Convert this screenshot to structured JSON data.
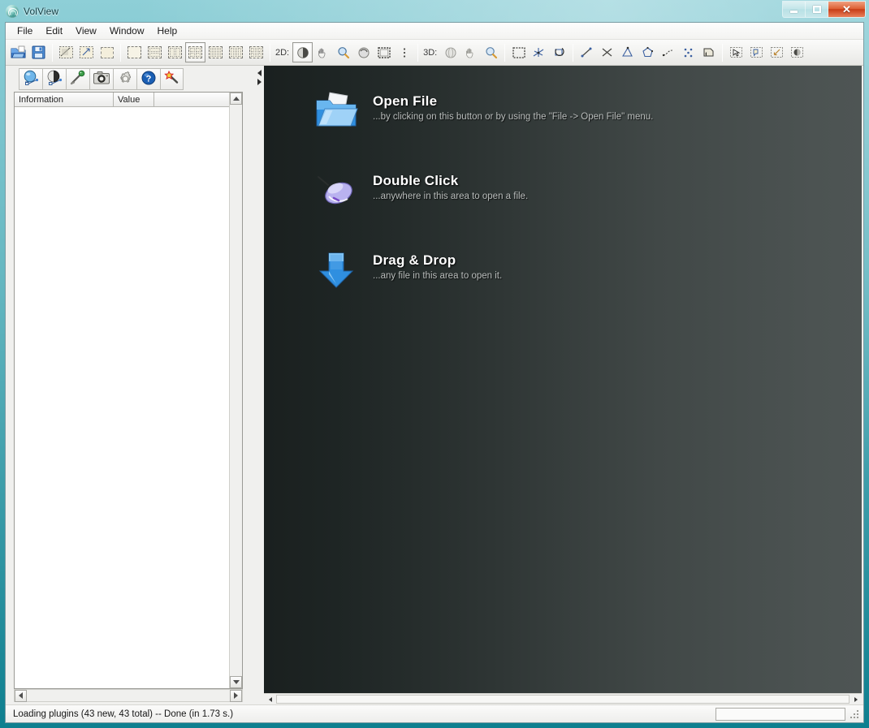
{
  "window": {
    "title": "VolView",
    "logo_icon": "volview-swirl-logo",
    "controls": {
      "minimize": {
        "icon": "minimize-icon",
        "label": "Minimize"
      },
      "maximize": {
        "icon": "maximize-icon",
        "label": "Maximize"
      },
      "close": {
        "icon": "close-icon",
        "label": "Close",
        "glyph": "✕"
      }
    }
  },
  "menubar": {
    "items": [
      {
        "label": "File"
      },
      {
        "label": "Edit"
      },
      {
        "label": "View"
      },
      {
        "label": "Window"
      },
      {
        "label": "Help"
      }
    ]
  },
  "toolbar": {
    "file_group": [
      {
        "name": "open-file-button",
        "icon": "open-folder-icon",
        "tooltip": "Open File"
      },
      {
        "name": "save-button",
        "icon": "floppy-save-icon",
        "tooltip": "Save"
      }
    ],
    "document_group": [
      {
        "name": "doc-crop-button",
        "icon": "document-crop-icon"
      },
      {
        "name": "doc-extract-button",
        "icon": "document-extract-icon"
      },
      {
        "name": "doc-blank-button",
        "icon": "document-blank-icon"
      }
    ],
    "layout_group": [
      {
        "name": "layout-single-button",
        "icon": "layout-single-icon",
        "selected": false
      },
      {
        "name": "layout-two-horizontal-button",
        "icon": "layout-2-horizontal-icon",
        "selected": false
      },
      {
        "name": "layout-two-vertical-button",
        "icon": "layout-2-vertical-icon",
        "selected": false
      },
      {
        "name": "layout-quad-button",
        "icon": "layout-quad-icon",
        "selected": true
      },
      {
        "name": "layout-one-plus-three-button",
        "icon": "layout-1-plus-3-icon",
        "selected": false
      },
      {
        "name": "layout-three-columns-button",
        "icon": "layout-3-columns-icon",
        "selected": false
      },
      {
        "name": "layout-six-grid-button",
        "icon": "layout-6-grid-icon",
        "selected": false
      }
    ],
    "mode_2d": {
      "label": "2D:",
      "tools": [
        {
          "name": "tool-2d-window-level-button",
          "icon": "window-level-icon",
          "selected": true
        },
        {
          "name": "tool-2d-pan-button",
          "icon": "hand-pan-icon",
          "selected": false
        },
        {
          "name": "tool-2d-zoom-button",
          "icon": "magnifier-zoom-icon",
          "selected": false
        },
        {
          "name": "tool-2d-rotate-button",
          "icon": "rotate-icon",
          "selected": false
        },
        {
          "name": "tool-2d-crop-button",
          "icon": "crop-box-icon",
          "selected": false
        },
        {
          "name": "tool-2d-more-button",
          "icon": "more-vertical-icon",
          "selected": false
        }
      ]
    },
    "mode_3d": {
      "label": "3D:",
      "tools": [
        {
          "name": "tool-3d-rotate-button",
          "icon": "sphere-rotate-icon",
          "selected": false
        },
        {
          "name": "tool-3d-pan-button",
          "icon": "hand-pan-icon",
          "selected": false
        },
        {
          "name": "tool-3d-zoom-button",
          "icon": "magnifier-zoom-icon",
          "selected": false
        }
      ]
    },
    "crop_group": [
      {
        "name": "crop-region-button",
        "icon": "crop-box-icon"
      },
      {
        "name": "axes-button",
        "icon": "axes-cross-icon"
      },
      {
        "name": "reset-view-button",
        "icon": "reset-rotate-icon"
      }
    ],
    "measure_group": [
      {
        "name": "measure-ruler-button",
        "icon": "ruler-distance-icon"
      },
      {
        "name": "measure-cross-button",
        "icon": "cross-distance-icon"
      },
      {
        "name": "measure-angle-button",
        "icon": "angle-icon"
      },
      {
        "name": "measure-polygon-button",
        "icon": "polygon-icon"
      },
      {
        "name": "measure-path-button",
        "icon": "path-points-icon"
      },
      {
        "name": "measure-scatter-button",
        "icon": "scatter-points-icon"
      },
      {
        "name": "measure-volume-button",
        "icon": "volume-measure-icon"
      }
    ],
    "annotate_group": [
      {
        "name": "annotate-select-button",
        "icon": "lasso-select-icon"
      },
      {
        "name": "annotate-note-button",
        "icon": "note-tag-icon"
      },
      {
        "name": "annotate-arrow-button",
        "icon": "arrow-tag-icon"
      },
      {
        "name": "annotate-fill-button",
        "icon": "fill-region-icon"
      }
    ]
  },
  "left_panel": {
    "tabs": [
      {
        "name": "tab-volume-properties",
        "icon": "blue-sphere-icon"
      },
      {
        "name": "tab-surface-properties",
        "icon": "gray-sphere-icon"
      },
      {
        "name": "tab-probe",
        "icon": "probe-pin-icon"
      },
      {
        "name": "tab-snapshot",
        "icon": "camera-icon"
      },
      {
        "name": "tab-settings",
        "icon": "gear-icon"
      },
      {
        "name": "tab-help",
        "icon": "help-question-icon"
      },
      {
        "name": "tab-plugins",
        "icon": "magic-wand-icon"
      }
    ],
    "info_table": {
      "columns": [
        "Information",
        "Value",
        ""
      ],
      "rows": []
    },
    "scrollbars": {
      "vertical": {
        "up_icon": "scroll-up-arrow-icon",
        "down_icon": "scroll-down-arrow-icon"
      },
      "horizontal": {
        "left_icon": "scroll-left-arrow-icon",
        "right_icon": "scroll-right-arrow-icon"
      }
    }
  },
  "splitter": {
    "collapse_left_icon": "collapse-left-arrow-icon",
    "collapse_right_icon": "collapse-right-arrow-icon"
  },
  "render_view": {
    "background_start": "#1a201f",
    "background_end": "#4e5554",
    "hints": [
      {
        "name": "hint-open-file",
        "icon": "open-folder-icon",
        "title": "Open File",
        "subtitle": "...by clicking on this button or by using the \"File -> Open File\" menu."
      },
      {
        "name": "hint-double-click",
        "icon": "computer-mouse-icon",
        "title": "Double Click",
        "subtitle": "...anywhere in this area to open a file."
      },
      {
        "name": "hint-drag-drop",
        "icon": "down-arrow-icon",
        "title": "Drag & Drop",
        "subtitle": "...any file in this area to open it."
      }
    ],
    "bottom_scrollbar": {
      "left_icon": "scroll-left-arrow-icon",
      "right_icon": "scroll-right-arrow-icon"
    }
  },
  "statusbar": {
    "message": "Loading plugins (43 new, 43 total) -- Done (in 1.73 s.)",
    "progress_value": 0,
    "resize_grip_icon": "resize-grip-icon"
  },
  "colors": {
    "frame_teal": "#63b6c0",
    "close_red": "#c73c16",
    "accent_blue": "#3f7fd0"
  }
}
